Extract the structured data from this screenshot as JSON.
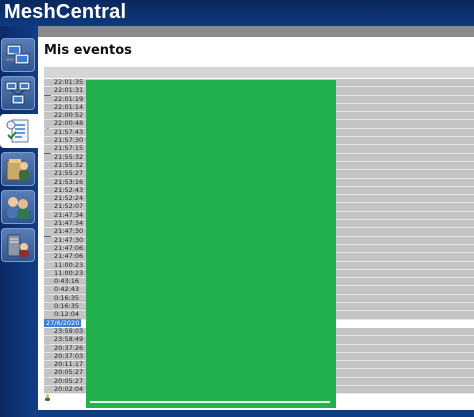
{
  "app": {
    "title": "MeshCentral"
  },
  "page": {
    "title": "Mis eventos"
  },
  "sidebar": {
    "items": [
      {
        "name": "devices",
        "icon": "computers-icon"
      },
      {
        "name": "device-groups",
        "icon": "network-icon"
      },
      {
        "name": "my-events",
        "icon": "events-list-icon",
        "active": true
      },
      {
        "name": "my-files",
        "icon": "folder-user-icon"
      },
      {
        "name": "users",
        "icon": "users-icon"
      },
      {
        "name": "server",
        "icon": "server-icon"
      }
    ]
  },
  "events": {
    "rows": [
      {
        "time": "22:01:35",
        "icon": "computer"
      },
      {
        "time": "22:01:31",
        "icon": "computer"
      },
      {
        "time": "22:01:19",
        "icon": "computer"
      },
      {
        "time": "22:01:14",
        "icon": "computer"
      },
      {
        "time": "22:00:52",
        "icon": "computer"
      },
      {
        "time": "22:00:48",
        "icon": "sync"
      },
      {
        "time": "21:57:43",
        "icon": "computer"
      },
      {
        "time": "21:57:30",
        "icon": "computer"
      },
      {
        "time": "21:57:15",
        "icon": "computer"
      },
      {
        "time": "21:55:32",
        "icon": "user"
      },
      {
        "time": "21:55:32",
        "icon": "user"
      },
      {
        "time": "21:55:27",
        "icon": "user"
      },
      {
        "time": "21:53:16",
        "icon": "user"
      },
      {
        "time": "21:52:43",
        "icon": "user"
      },
      {
        "time": "21:52:24",
        "icon": "computer"
      },
      {
        "time": "21:52:07",
        "icon": "user"
      },
      {
        "time": "21:47:34",
        "icon": "computer"
      },
      {
        "time": "21:47:34",
        "icon": "computer"
      },
      {
        "time": "21:47:30",
        "icon": "computer"
      },
      {
        "time": "21:47:30",
        "icon": "computer"
      },
      {
        "time": "21:47:06",
        "icon": "user"
      },
      {
        "time": "21:47:06",
        "icon": "user"
      },
      {
        "time": "11:00:23",
        "icon": "user"
      },
      {
        "time": "11:00:23",
        "icon": "user"
      },
      {
        "time": "0:43:16",
        "icon": "user"
      },
      {
        "time": "0:42:43",
        "icon": "user"
      },
      {
        "time": "0:16:35",
        "icon": "user"
      },
      {
        "time": "0:16:35",
        "icon": "user"
      },
      {
        "time": "0:12:04",
        "icon": "user"
      },
      {
        "time": "27/6/2020",
        "icon": "none",
        "date": true
      },
      {
        "time": "23:59:03",
        "icon": "computer"
      },
      {
        "time": "23:58:49",
        "icon": "user"
      },
      {
        "time": "20:37:26",
        "icon": "user"
      },
      {
        "time": "20:37:03",
        "icon": "user"
      },
      {
        "time": "20:11:17",
        "icon": "computer"
      },
      {
        "time": "20:05:27",
        "icon": "user"
      },
      {
        "time": "20:05:27",
        "icon": "user"
      },
      {
        "time": "20:02:04",
        "icon": "user"
      }
    ]
  },
  "colors": {
    "header": "#0e3a80",
    "overlay": "#22b14c",
    "row": "#c4c4c4",
    "date_highlight": "#3c7fd8"
  }
}
